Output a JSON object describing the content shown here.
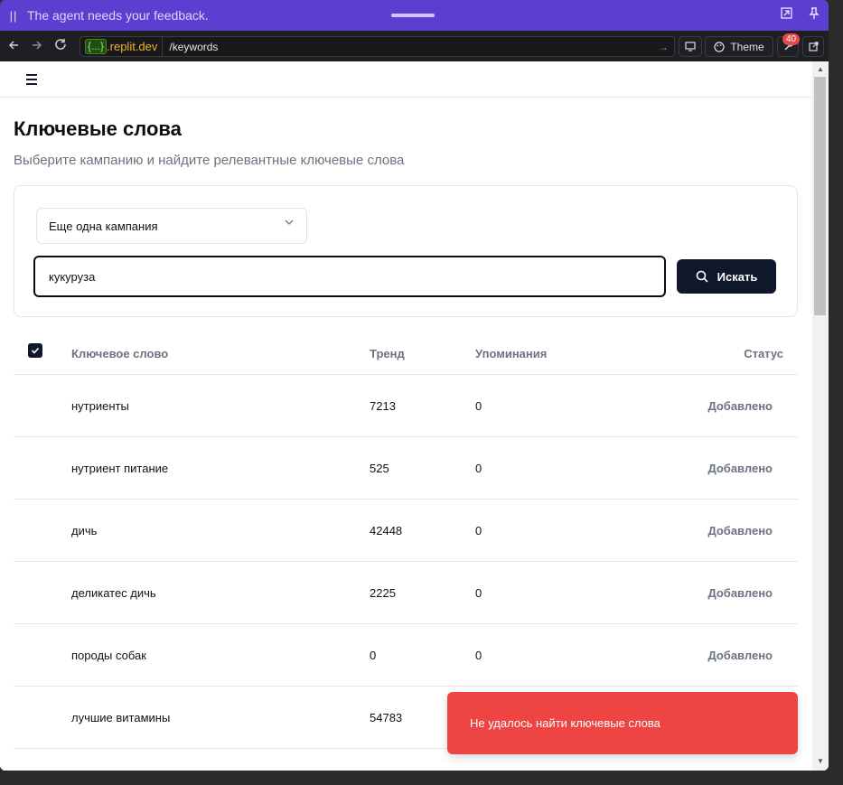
{
  "agent_bar": {
    "message": "The agent needs your feedback."
  },
  "browser": {
    "domain_badge": "{...}",
    "domain_host": ".replit.dev",
    "path": "/keywords",
    "theme_label": "Theme",
    "notification_count": "40"
  },
  "page": {
    "title": "Ключевые слова",
    "subtitle": "Выберите кампанию и найдите релевантные ключевые слова",
    "campaign_select": "Еще одна кампания",
    "search_value": "кукуруза",
    "search_button": "Искать"
  },
  "table": {
    "headers": {
      "keyword": "Ключевое слово",
      "trend": "Тренд",
      "mentions": "Упоминания",
      "status": "Статус"
    },
    "rows": [
      {
        "keyword": "нутриенты",
        "trend": "7213",
        "mentions": "0",
        "status": "Добавлено"
      },
      {
        "keyword": "нутриент питание",
        "trend": "525",
        "mentions": "0",
        "status": "Добавлено"
      },
      {
        "keyword": "дичь",
        "trend": "42448",
        "mentions": "0",
        "status": "Добавлено"
      },
      {
        "keyword": "деликатес дичь",
        "trend": "2225",
        "mentions": "0",
        "status": "Добавлено"
      },
      {
        "keyword": "породы собак",
        "trend": "0",
        "mentions": "0",
        "status": "Добавлено"
      },
      {
        "keyword": "лучшие витамины",
        "trend": "54783",
        "mentions": "",
        "status": ""
      }
    ]
  },
  "toast": {
    "message": "Не удалось найти ключевые слова"
  },
  "colors": {
    "agent_bar": "#5a3fd0",
    "primary_button": "#0f172a",
    "toast": "#ef4444"
  }
}
